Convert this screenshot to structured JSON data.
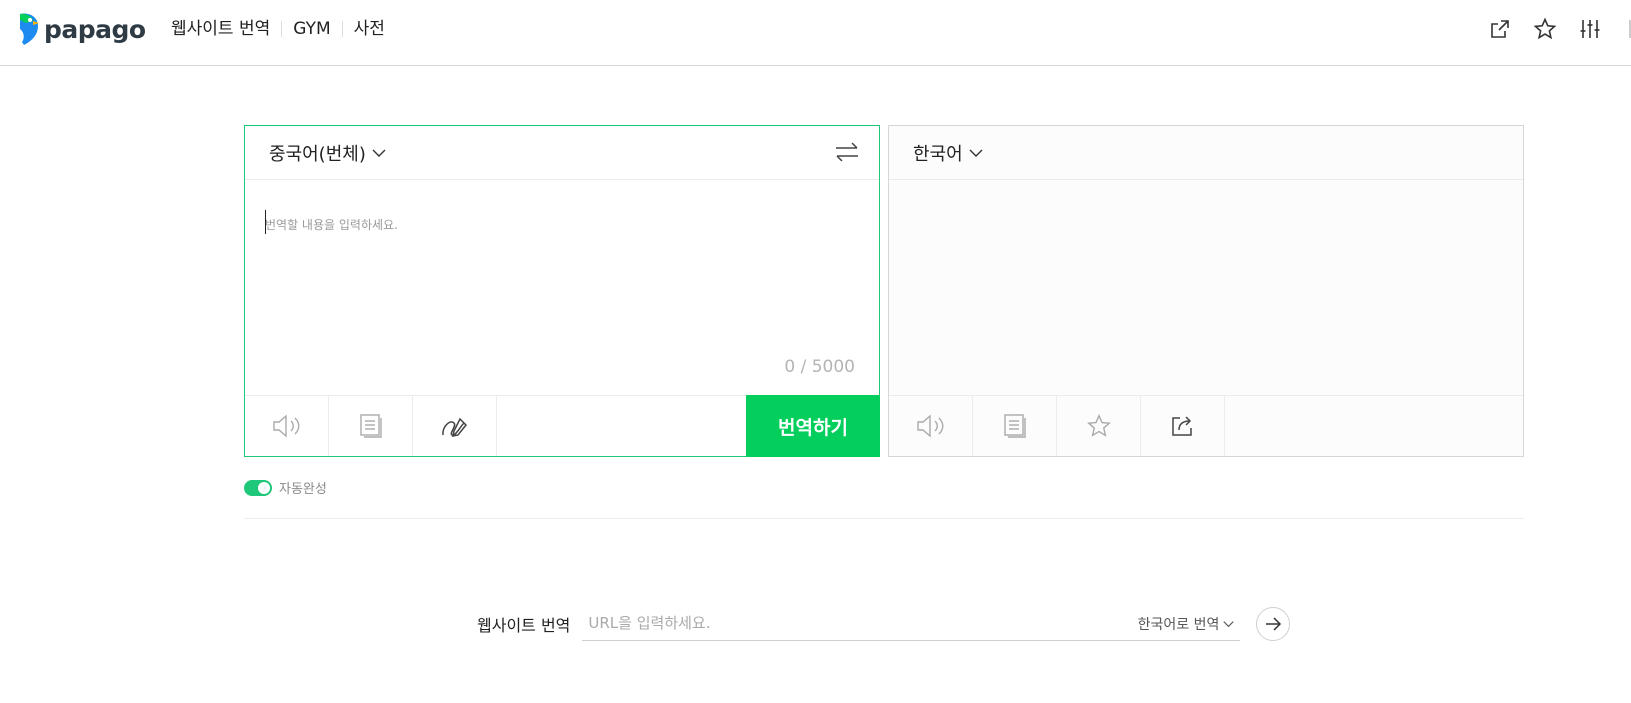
{
  "header": {
    "logo_text": "papago",
    "nav": [
      {
        "label": "웹사이트 번역"
      },
      {
        "label": "GYM"
      },
      {
        "label": "사전"
      }
    ],
    "icons": [
      "external-link-icon",
      "star-icon",
      "settings-sliders-icon"
    ]
  },
  "source_panel": {
    "language": "중국어(번체)",
    "placeholder": "번역할 내용을 입력하세요.",
    "counter": "0 / 5000",
    "translate_label": "번역하기",
    "tools": [
      "speaker-icon",
      "document-icon",
      "handwriting-icon"
    ]
  },
  "target_panel": {
    "language": "한국어",
    "tools": [
      "speaker-icon",
      "copy-icon",
      "star-icon",
      "share-icon"
    ]
  },
  "autocomplete": {
    "label": "자동완성",
    "enabled": true
  },
  "website_translation": {
    "label": "웹사이트 번역",
    "placeholder": "URL을 입력하세요.",
    "target_lang": "한국어로 번역"
  },
  "colors": {
    "accent": "#04cf5c",
    "panel_border_active": "#1ec77a"
  }
}
